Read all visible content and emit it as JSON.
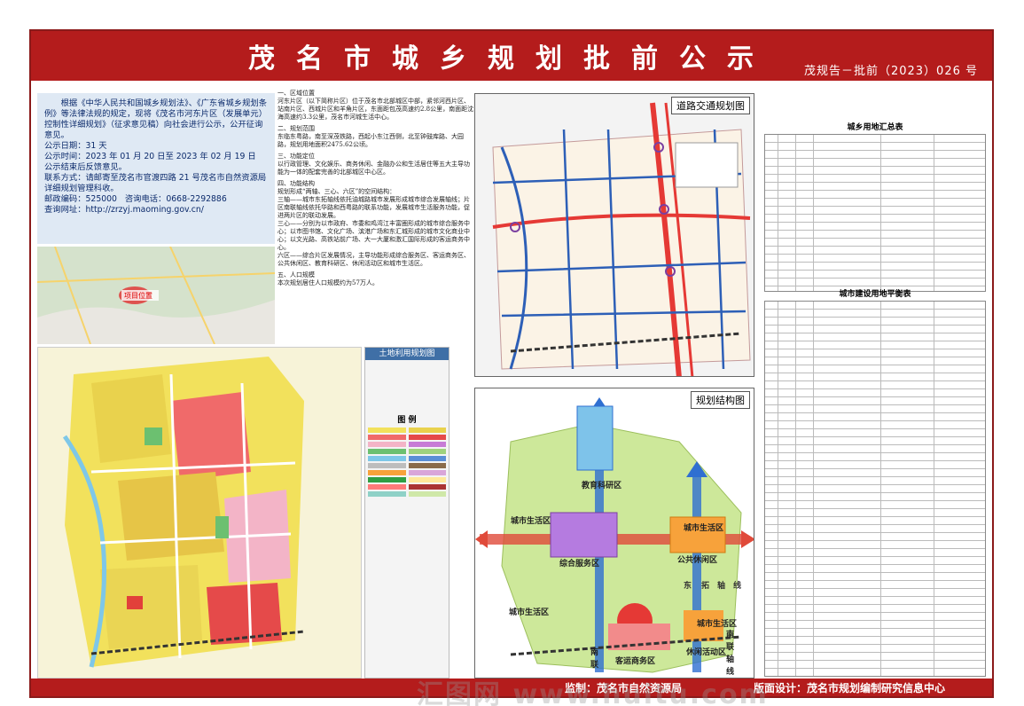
{
  "header": {
    "title": "茂名市城乡规划批前公示",
    "doc_number": "茂规告－批前（2023）026 号"
  },
  "notice": {
    "intro": "根据《中华人民共和国城乡规划法》、《广东省城乡规划条例》等法律法规的规定，现将《茂名市河东片区（发展单元）控制性详细规划》（征求意见稿）向社会进行公示，公开征询意见。",
    "period": "公示日期：31 天",
    "dates": "公示时间：2023 年 01 月 20 日至 2023 年 02 月 19 日",
    "ended": "公示结束后反馈意见。",
    "contact": "联系方式：请邮寄至茂名市官渡四路 21 号茂名市自然资源局详细规划管理科收。",
    "zip": "邮政编码：525000",
    "phone": "咨询电话：0668-2292886",
    "web": "查询网址：http://zrzyj.maoming.gov.cn/"
  },
  "description": [
    "一、区域位置",
    "河东片区（以下简称片区）位于茂名市北部城区中部，紧邻河西片区、站南片区、西城片区和羊角片区，东面距包茂高速约2.8公里，南面距沈海高速约3.3公里，茂名市河城生活中心。",
    "二、规划范围",
    "东临东粤路，南至深茂铁路，西起小东江西侧，北至钟鼓库路、大园路，规划用地面积2475.62公顷。",
    "三、功能定位",
    "以行政管理、文化娱乐、商务休闲、金融办公和生活居住等五大主导功能为一体的配套完善的北部城区中心区。",
    "四、功能结构",
    "规划形成“两轴、三心、六区”的空间结构：",
    "三轴——城市东拓轴线依托油城路城市发展形成城市综合发展轴线；片区南联轴线依托华路和西粤路的联系功能，发展城市生活服务功能，促进两片区的联动发展。",
    "三心——分别为以市政府、市委和鸡湾江丰富圈形成的城市综合服务中心；以市图书馆、文化广场、滨港广场和东汇城形成的城市文化商业中心；以文光路、高铁站前广场、大一大厦和激汇国际形成的客运商务中心。",
    "六区——综合片区发展情况，主导功能形成综合服务区、客运商务区、公共休闲区、教育科研区、休闲活动区和城市生活区。",
    "五、人口规模",
    "本次规划居住人口规模约为57万人。"
  ],
  "maps": {
    "location_label": "项目位置",
    "land_use_title": "土地利用规划图",
    "legend_heading": "图 例",
    "road_title": "道路交通规划图",
    "structure_title": "规划结构图",
    "structure_labels": [
      "教育科研区",
      "城市生活区",
      "城市生活区",
      "综合服务区",
      "公共休闲区",
      "东",
      "拓",
      "轴",
      "线",
      "城市生活区",
      "城市生活区",
      "南",
      "联",
      "轴",
      "线",
      "客运商务区",
      "休闲活动区",
      "南",
      "联",
      "轴",
      "线"
    ]
  },
  "tables": {
    "summary_title": "城乡用地汇总表",
    "balance_title": "城市建设用地平衡表"
  },
  "footer": {
    "supervisor": "监制：茂名市自然资源局",
    "designer": "版面设计：茂名市规划编制研究信息中心"
  },
  "watermark": "汇图网 www.huitu.com",
  "colors": {
    "accent": "#b41c1c",
    "notice_bg": "#dfe9f4",
    "notice_text": "#0b2a6b"
  }
}
